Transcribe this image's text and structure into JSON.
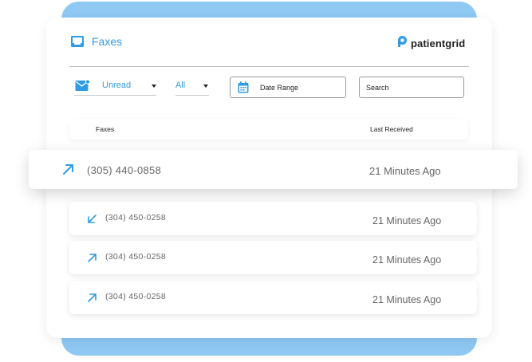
{
  "header": {
    "title": "Faxes",
    "brand_name": "patientgrid"
  },
  "filters": {
    "status": {
      "selected": "Unread"
    },
    "category": {
      "selected": "All"
    },
    "date_range": {
      "placeholder": "Date Range"
    },
    "search": {
      "placeholder": "Search"
    }
  },
  "table": {
    "columns": [
      "Faxes",
      "Last Received"
    ],
    "rows": [
      {
        "number": "(305) 440-0858",
        "last_received": "21 Minutes Ago",
        "direction": "outgoing",
        "highlighted": true
      },
      {
        "number": "(304) 450-0258",
        "last_received": "21 Minutes Ago",
        "direction": "incoming"
      },
      {
        "number": "(304) 450-0258",
        "last_received": "21 Minutes Ago",
        "direction": "outgoing"
      },
      {
        "number": "(304) 450-0258",
        "last_received": "21 Minutes Ago",
        "direction": "outgoing"
      }
    ]
  },
  "colors": {
    "accent": "#2e9be6",
    "backdrop": "#8ec8f3"
  },
  "icons": [
    "inbox-icon",
    "patientgrid-logo-icon",
    "mail-icon",
    "calendar-icon",
    "outgoing-arrow-icon",
    "incoming-arrow-icon"
  ]
}
